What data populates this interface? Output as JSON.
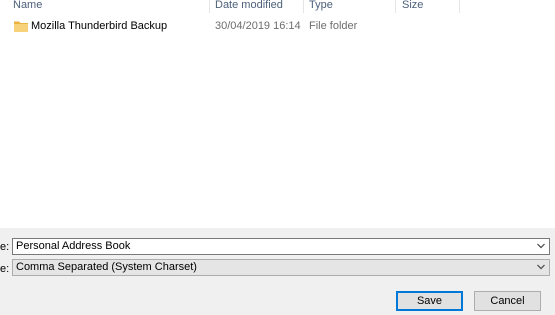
{
  "columns": {
    "name": "Name",
    "date_modified": "Date modified",
    "type": "Type",
    "size": "Size"
  },
  "files": [
    {
      "name": "Mozilla Thunderbird Backup",
      "date_modified": "30/04/2019 16:14",
      "type": "File folder",
      "icon": "folder-icon"
    }
  ],
  "form": {
    "file_name_label": "e:",
    "file_name_value": "Personal Address Book",
    "save_type_label": "e:",
    "save_type_value": "Comma Separated (System Charset)"
  },
  "buttons": {
    "save": "Save",
    "cancel": "Cancel"
  },
  "colors": {
    "accent": "#0078d7",
    "folder": "#f3c65a"
  }
}
